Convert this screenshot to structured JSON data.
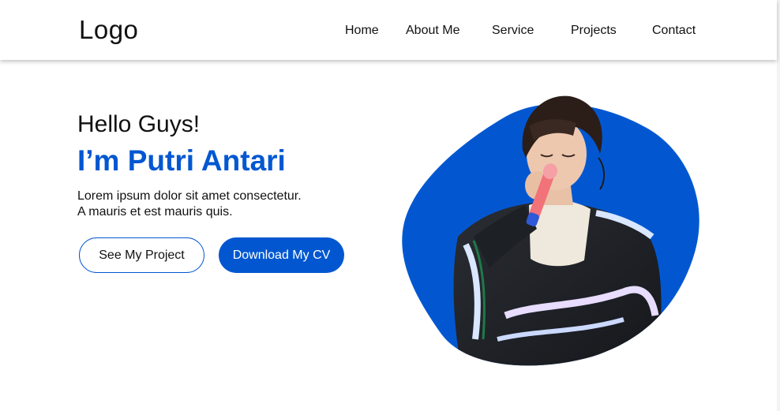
{
  "nav": {
    "logo": "Logo",
    "links": [
      "Home",
      "About Me",
      "Service",
      "Projects",
      "Contact"
    ]
  },
  "hero": {
    "greeting": "Hello Guys!",
    "name": "I’m Putri Antari",
    "description_line1": "Lorem ipsum dolor sit amet consectetur.",
    "description_line2": "A mauris et est mauris quis.",
    "primary_button": "See My Project",
    "secondary_button": "Download My CV"
  },
  "colors": {
    "accent": "#0257d1",
    "text": "#111111",
    "background": "#ffffff"
  },
  "icons": {
    "hero_image": "portrait-photo-singer"
  }
}
